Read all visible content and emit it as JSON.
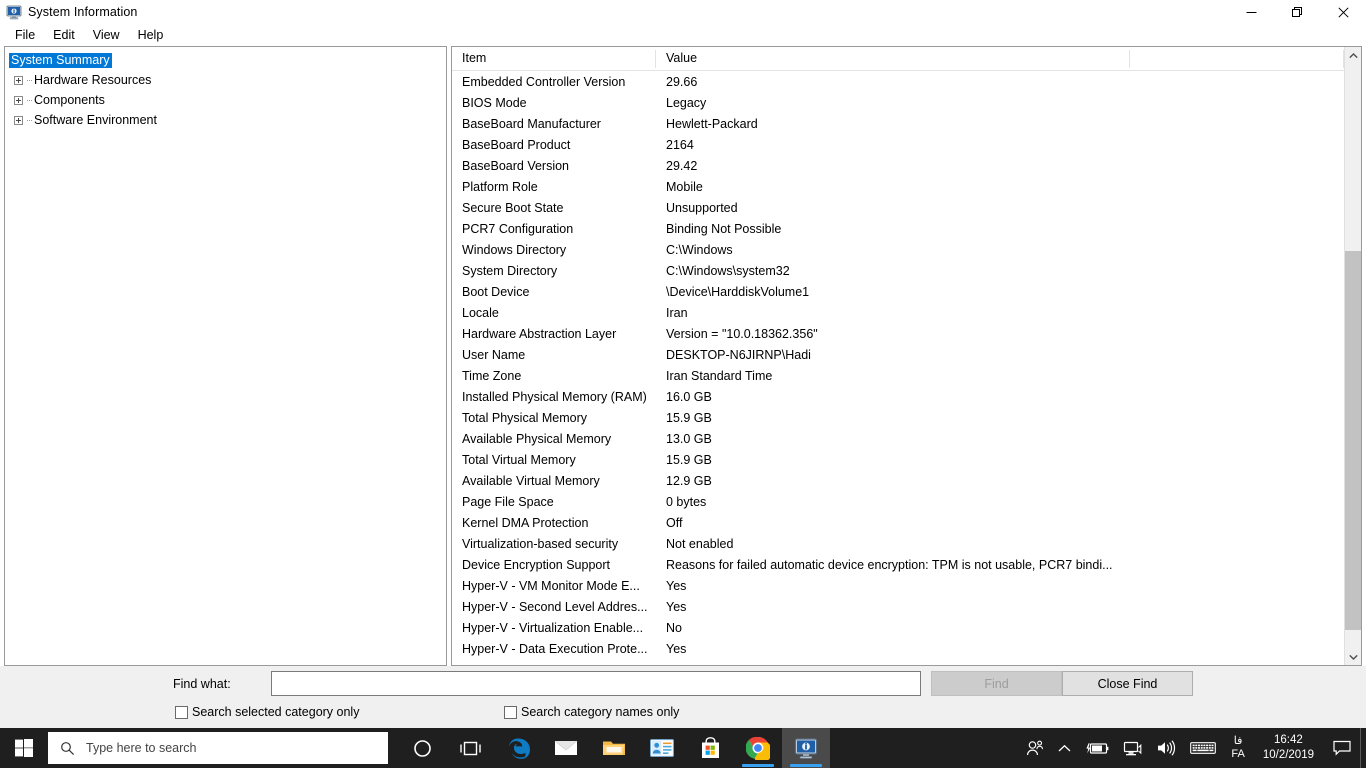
{
  "window": {
    "title": "System Information",
    "icon": "monitor-info-icon",
    "controls": {
      "minimize": "minimize-icon",
      "restore": "restore-icon",
      "close": "close-icon"
    }
  },
  "menu": {
    "items": [
      {
        "label": "File"
      },
      {
        "label": "Edit"
      },
      {
        "label": "View"
      },
      {
        "label": "Help"
      }
    ]
  },
  "tree": {
    "root": {
      "label": "System Summary",
      "selected": true
    },
    "nodes": [
      {
        "label": "Hardware Resources",
        "expanded": false
      },
      {
        "label": "Components",
        "expanded": false
      },
      {
        "label": "Software Environment",
        "expanded": false
      }
    ]
  },
  "list": {
    "columns": [
      "Item",
      "Value"
    ],
    "rows": [
      {
        "item": "Embedded Controller Version",
        "value": "29.66"
      },
      {
        "item": "BIOS Mode",
        "value": "Legacy"
      },
      {
        "item": "BaseBoard Manufacturer",
        "value": "Hewlett-Packard"
      },
      {
        "item": "BaseBoard Product",
        "value": "2164"
      },
      {
        "item": "BaseBoard Version",
        "value": "29.42"
      },
      {
        "item": "Platform Role",
        "value": "Mobile"
      },
      {
        "item": "Secure Boot State",
        "value": "Unsupported"
      },
      {
        "item": "PCR7 Configuration",
        "value": "Binding Not Possible"
      },
      {
        "item": "Windows Directory",
        "value": "C:\\Windows"
      },
      {
        "item": "System Directory",
        "value": "C:\\Windows\\system32"
      },
      {
        "item": "Boot Device",
        "value": "\\Device\\HarddiskVolume1"
      },
      {
        "item": "Locale",
        "value": "Iran"
      },
      {
        "item": "Hardware Abstraction Layer",
        "value": "Version = \"10.0.18362.356\""
      },
      {
        "item": "User Name",
        "value": "DESKTOP-N6JIRNP\\Hadi"
      },
      {
        "item": "Time Zone",
        "value": "Iran Standard Time"
      },
      {
        "item": "Installed Physical Memory (RAM)",
        "value": "16.0 GB"
      },
      {
        "item": "Total Physical Memory",
        "value": "15.9 GB"
      },
      {
        "item": "Available Physical Memory",
        "value": "13.0 GB"
      },
      {
        "item": "Total Virtual Memory",
        "value": "15.9 GB"
      },
      {
        "item": "Available Virtual Memory",
        "value": "12.9 GB"
      },
      {
        "item": "Page File Space",
        "value": "0 bytes"
      },
      {
        "item": "Kernel DMA Protection",
        "value": "Off"
      },
      {
        "item": "Virtualization-based security",
        "value": "Not enabled"
      },
      {
        "item": "Device Encryption Support",
        "value": "Reasons for failed automatic device encryption: TPM is not usable, PCR7 bindi..."
      },
      {
        "item": "Hyper-V - VM Monitor Mode E...",
        "value": "Yes"
      },
      {
        "item": "Hyper-V - Second Level Addres...",
        "value": "Yes"
      },
      {
        "item": "Hyper-V - Virtualization Enable...",
        "value": "No"
      },
      {
        "item": "Hyper-V - Data Execution Prote...",
        "value": "Yes"
      }
    ]
  },
  "scrollbar": {
    "up_icon": "chevron-up-icon",
    "down_icon": "chevron-down-icon",
    "thumb_top_pct": 32,
    "thumb_height_pct": 65
  },
  "find_bar": {
    "find_what_label": "Find what:",
    "input_value": "",
    "input_placeholder": "",
    "find_button": {
      "label": "Find",
      "enabled": false
    },
    "close_find_button": {
      "label": "Close Find",
      "enabled": true
    },
    "checkboxes": [
      {
        "label": "Search selected category only",
        "checked": false
      },
      {
        "label": "Search category names only",
        "checked": false
      }
    ]
  },
  "taskbar": {
    "start_icon": "windows-logo-icon",
    "search": {
      "placeholder": "Type here to search",
      "icon": "search-icon"
    },
    "buttons": [
      {
        "name": "cortana",
        "icon": "cortana-circle-icon",
        "running": false
      },
      {
        "name": "task-view",
        "icon": "task-view-icon",
        "running": false
      },
      {
        "name": "edge",
        "icon": "edge-icon",
        "running": false
      },
      {
        "name": "mail",
        "icon": "mail-icon",
        "running": false
      },
      {
        "name": "file-explorer",
        "icon": "folder-icon",
        "running": false
      },
      {
        "name": "contacts",
        "icon": "contact-card-icon",
        "running": false
      },
      {
        "name": "microsoft-store",
        "icon": "store-bag-icon",
        "running": false
      },
      {
        "name": "chrome",
        "icon": "chrome-icon",
        "running": true
      },
      {
        "name": "system-information",
        "icon": "monitor-info-icon",
        "running": true,
        "active": true
      }
    ],
    "tray": {
      "people_icon": "people-icon",
      "overflow_icon": "chevron-up-icon",
      "battery_icon": "battery-charging-icon",
      "network_icon": "network-icon",
      "volume_icon": "volume-icon",
      "keyboard_icon": "keyboard-icon",
      "language_top": "فا",
      "language_bottom": "FA",
      "time": "16:42",
      "date": "10/2/2019",
      "action_center_icon": "notification-icon"
    }
  },
  "colors": {
    "accent": "#0078d7",
    "taskbar_bg": "#1f1f1f",
    "window_bg": "#ffffff",
    "findbar_bg": "#f0f0f0",
    "scroll_thumb": "#c2c2c2"
  }
}
